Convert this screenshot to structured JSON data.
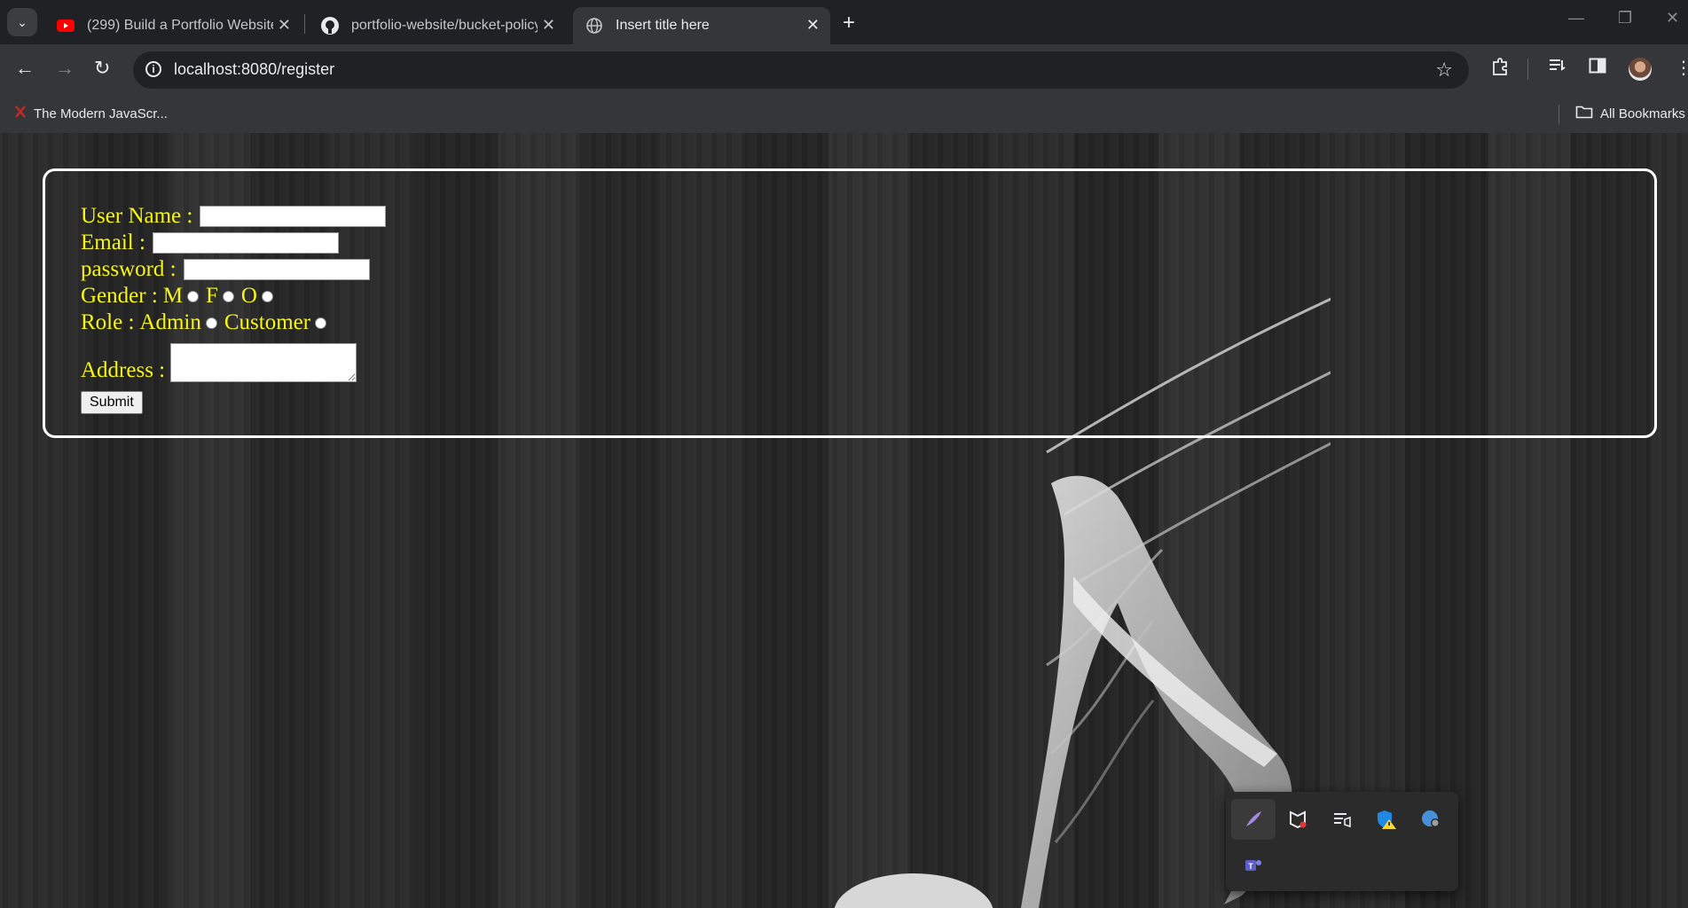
{
  "browser": {
    "tabs": [
      {
        "title": "(299) Build a Portfolio Website (",
        "icon": "youtube-icon",
        "active": false
      },
      {
        "title": "portfolio-website/bucket-policy",
        "icon": "github-icon",
        "active": false
      },
      {
        "title": "Insert title here",
        "icon": "globe-icon",
        "active": true
      }
    ],
    "url": "localhost:8080/register",
    "bookmarks": [
      {
        "label": "The Modern JavaScr...",
        "icon": "js-bookmark-icon"
      }
    ],
    "all_bookmarks_label": "All Bookmarks"
  },
  "form": {
    "username_label": "User Name :",
    "email_label": "Email :",
    "password_label": "password :",
    "gender_label": "Gender :",
    "gender_options": [
      "M",
      "F",
      "O"
    ],
    "role_label": "Role :",
    "role_options": [
      "Admin",
      "Customer"
    ],
    "address_label": "Address :",
    "submit_label": "Submit"
  },
  "colors": {
    "label_text": "#f5f51a",
    "box_border": "#ffffff",
    "chrome_dark": "#202124",
    "chrome_mid": "#35363a"
  }
}
